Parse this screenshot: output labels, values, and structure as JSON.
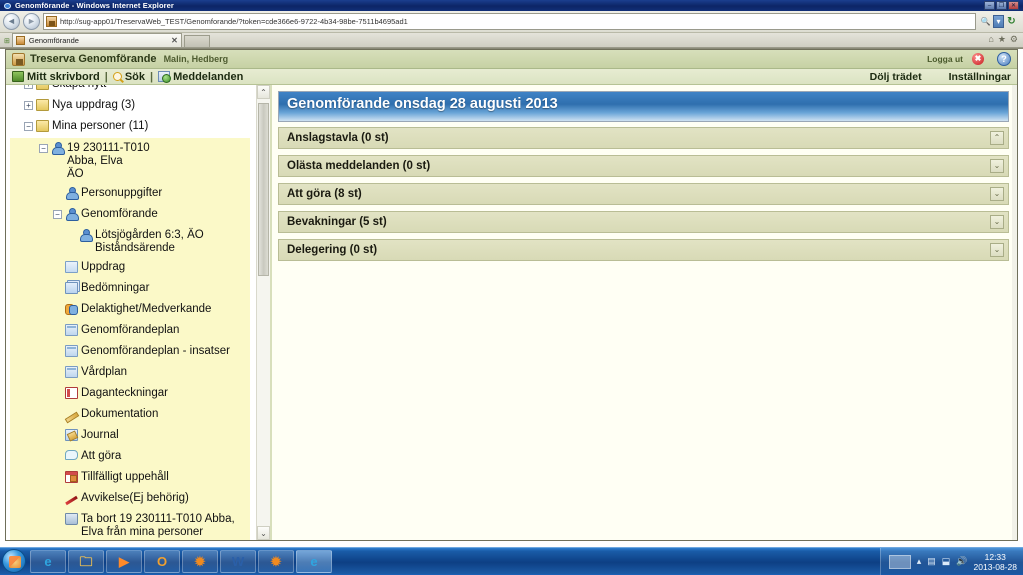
{
  "window": {
    "title": "Genomförande - Windows Internet Explorer",
    "minimize": "–",
    "maximize": "❐",
    "close": "✕"
  },
  "browser": {
    "back_icon": "◄",
    "forward_icon": "►",
    "url": "http://sug-app01/TreservaWeb_TEST/Genomforande/?token=cde366e6-9722-4b34-98be-7511b4695ad1",
    "url_host": "sug-app01",
    "search_icon": "🔍",
    "dropdown_icon": "▾",
    "refresh_icon": "↻",
    "tab_label": "Genomförande",
    "tab_close": "✕",
    "home_icon": "⌂",
    "favorites_icon": "★",
    "tools_icon": "⚙"
  },
  "app": {
    "title": "Treserva Genomförande",
    "user": "Malin, Hedberg",
    "logout_label": "Logga ut",
    "logout_icon": "✖",
    "help_icon": "?",
    "menu": {
      "desktop": "Mitt skrivbord",
      "separator": "|",
      "search": "Sök",
      "messages": "Meddelanden",
      "hide_tree": "Dölj trädet",
      "settings": "Inställningar"
    }
  },
  "tree": {
    "scroll_up_icon": "⌃",
    "scroll_down_icon": "⌄",
    "nodes": [
      {
        "label": "Skapa nytt",
        "icon": "folder-icon",
        "expander": "+",
        "indent": 1,
        "highlight": false
      },
      {
        "label": "Nya uppdrag (3)",
        "icon": "folder-icon",
        "expander": "+",
        "indent": 1,
        "highlight": false
      },
      {
        "label": "Mina personer (11)",
        "icon": "folder-icon",
        "expander": "−",
        "indent": 1,
        "highlight": false
      },
      {
        "label": "19 230111-T010\nAbba, Elva\nÄO",
        "icon": "person-icon",
        "expander": "−",
        "indent": 2,
        "highlight": true
      },
      {
        "label": "Personuppgifter",
        "icon": "person-icon",
        "expander": "",
        "indent": 3,
        "highlight": true
      },
      {
        "label": "Genomförande",
        "icon": "person-icon",
        "expander": "−",
        "indent": 3,
        "highlight": true
      },
      {
        "label": "Lötsjögården 6:3, ÄO\nBiståndsärende",
        "icon": "person-icon",
        "expander": "",
        "indent": 4,
        "highlight": true
      },
      {
        "label": "Uppdrag",
        "icon": "doc-icon",
        "expander": "",
        "indent": 3,
        "highlight": true
      },
      {
        "label": "Bedömningar",
        "icon": "docs-icon",
        "expander": "",
        "indent": 3,
        "highlight": true
      },
      {
        "label": "Delaktighet/Medverkande",
        "icon": "people-icon",
        "expander": "",
        "indent": 3,
        "highlight": true
      },
      {
        "label": "Genomförandeplan",
        "icon": "plan-icon",
        "expander": "",
        "indent": 3,
        "highlight": true
      },
      {
        "label": "Genomförandeplan - insatser",
        "icon": "plan-icon",
        "expander": "",
        "indent": 3,
        "highlight": true
      },
      {
        "label": "Vårdplan",
        "icon": "plan-icon",
        "expander": "",
        "indent": 3,
        "highlight": true
      },
      {
        "label": "Daganteckningar",
        "icon": "note-icon",
        "expander": "",
        "indent": 3,
        "highlight": true
      },
      {
        "label": "Dokumentation",
        "icon": "pen-icon",
        "expander": "",
        "indent": 3,
        "highlight": true
      },
      {
        "label": "Journal",
        "icon": "journal-icon",
        "expander": "",
        "indent": 3,
        "highlight": true
      },
      {
        "label": "Att göra",
        "icon": "bubble-icon",
        "expander": "",
        "indent": 3,
        "highlight": true
      },
      {
        "label": "Tillfälligt uppehåll",
        "icon": "calendar-icon",
        "expander": "",
        "indent": 3,
        "highlight": true
      },
      {
        "label": "Avvikelse(Ej behörig)",
        "icon": "deviation-icon",
        "expander": "",
        "indent": 3,
        "highlight": true
      },
      {
        "label": "Ta bort 19 230111-T010 Abba, Elva från mina personer",
        "icon": "trash-icon",
        "expander": "",
        "indent": 3,
        "highlight": true
      }
    ]
  },
  "content": {
    "panel_title": "Genomförande onsdag 28 augusti 2013",
    "sections": [
      {
        "label": "Anslagstavla (0 st)",
        "state": "expanded",
        "toggle_icon": "⌃"
      },
      {
        "label": "Olästa meddelanden (0 st)",
        "state": "collapsed",
        "toggle_icon": "⌄"
      },
      {
        "label": "Att göra (8 st)",
        "state": "collapsed",
        "toggle_icon": "⌄"
      },
      {
        "label": "Bevakningar (5 st)",
        "state": "collapsed",
        "toggle_icon": "⌄"
      },
      {
        "label": "Delegering (0 st)",
        "state": "collapsed",
        "toggle_icon": "⌄"
      }
    ]
  },
  "taskbar": {
    "start_label": "Start",
    "items": [
      {
        "name": "internet-explorer",
        "glyph": "e",
        "color": "#2fa5e0",
        "active": false
      },
      {
        "name": "windows-explorer",
        "glyph": "🗀",
        "color": "#f5c451",
        "active": false
      },
      {
        "name": "media-player",
        "glyph": "▶",
        "color": "#ff8a2a",
        "active": false
      },
      {
        "name": "outlook",
        "glyph": "O",
        "color": "#f0a030",
        "active": false
      },
      {
        "name": "treserva-app-1",
        "glyph": "✹",
        "color": "#f08a20",
        "active": false
      },
      {
        "name": "word-document",
        "glyph": "W",
        "color": "#2a5fa8",
        "active": false
      },
      {
        "name": "treserva-app-2",
        "glyph": "✹",
        "color": "#f08a20",
        "active": false
      },
      {
        "name": "internet-explorer-active",
        "glyph": "e",
        "color": "#2fa5e0",
        "active": true
      }
    ],
    "tray": {
      "show_hidden_icon": "▴",
      "network_icon": "▤",
      "action_icon": "⬓",
      "volume_icon": "🔊",
      "time": "12:33",
      "date": "2013-08-28"
    }
  }
}
